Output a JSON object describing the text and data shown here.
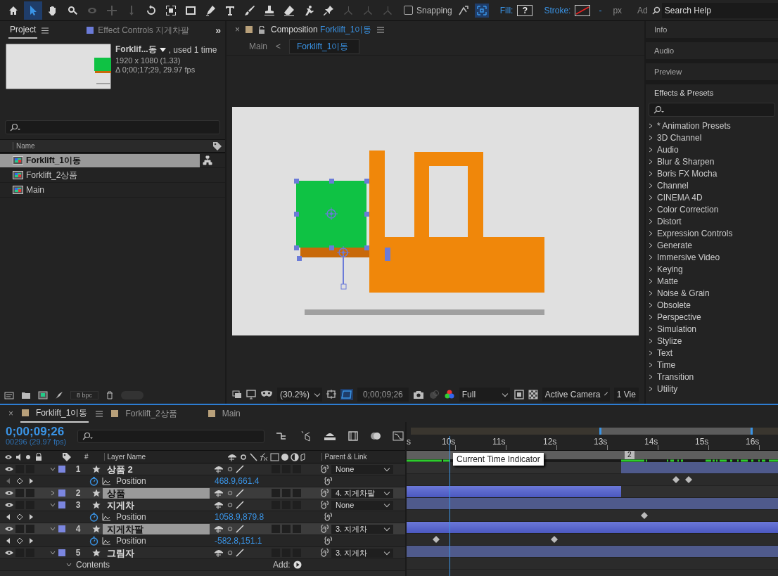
{
  "toolbar": {
    "tools": [
      {
        "kind": "home",
        "selected": false,
        "disabled": false
      },
      {
        "kind": "arrow",
        "selected": true,
        "disabled": false
      },
      {
        "kind": "hand",
        "selected": false,
        "disabled": false
      },
      {
        "kind": "zoom",
        "selected": false,
        "disabled": false
      },
      {
        "kind": "orbit",
        "selected": false,
        "disabled": true
      },
      {
        "kind": "pan",
        "selected": false,
        "disabled": true
      },
      {
        "kind": "dolly",
        "selected": false,
        "disabled": true
      },
      {
        "kind": "rotate",
        "selected": false,
        "disabled": false
      },
      {
        "kind": "region",
        "selected": false,
        "disabled": false
      },
      {
        "kind": "rectangle",
        "selected": false,
        "disabled": false
      },
      {
        "kind": "pen",
        "selected": false,
        "disabled": false
      },
      {
        "kind": "type",
        "selected": false,
        "disabled": false
      },
      {
        "kind": "brush",
        "selected": false,
        "disabled": false
      },
      {
        "kind": "stamp",
        "selected": false,
        "disabled": false
      },
      {
        "kind": "eraser",
        "selected": false,
        "disabled": false
      },
      {
        "kind": "puppet",
        "selected": false,
        "disabled": false
      },
      {
        "kind": "pin",
        "selected": false,
        "disabled": false
      },
      {
        "kind": "axis",
        "selected": false,
        "disabled": true
      },
      {
        "kind": "axis",
        "selected": false,
        "disabled": true
      },
      {
        "kind": "axis",
        "selected": false,
        "disabled": true
      }
    ],
    "snapping": {
      "label": "Snapping",
      "checked": false
    },
    "fill_label": "Fill:",
    "fill_value": "?",
    "stroke_label": "Stroke:",
    "stroke_width": "-",
    "stroke_unit": "px",
    "add_label": "Ad",
    "search": {
      "placeholder": "Search Help"
    }
  },
  "project": {
    "tabs": [
      {
        "label": "Project",
        "selected": true
      },
      {
        "label": "Effect Controls 지게차팔",
        "selected": false
      }
    ],
    "more": "»",
    "info": {
      "name": "Forklif...동",
      "usage": ", used 1 time",
      "size": "1920 x 1080 (1.33)",
      "duration": "Δ 0;00;17;29, 29.97 fps"
    },
    "column": "Name",
    "items": [
      {
        "name": "Forklift_1이동",
        "selected": true
      },
      {
        "name": "Forklift_2상품",
        "selected": false
      },
      {
        "name": "Main",
        "selected": false
      }
    ],
    "depth": "8 bpc"
  },
  "composition": {
    "close": "×",
    "tab_prefix": "Composition",
    "tab_name": "Forklift_1이동",
    "breadcrumb_root": "Main",
    "breadcrumb_sep": "<",
    "breadcrumb_current": "Forklift_1이동",
    "zoom": "(30.2%)",
    "timecode": "0;00;09;26",
    "resolution": "Full",
    "camera": "Active Camera",
    "views": "1 Vie"
  },
  "right_panels": [
    {
      "title": "Info"
    },
    {
      "title": "Audio"
    },
    {
      "title": "Preview"
    },
    {
      "title": "Effects & Presets"
    }
  ],
  "effects": [
    "* Animation Presets",
    "3D Channel",
    "Audio",
    "Blur & Sharpen",
    "Boris FX Mocha",
    "Channel",
    "CINEMA 4D",
    "Color Correction",
    "Distort",
    "Expression Controls",
    "Generate",
    "Immersive Video",
    "Keying",
    "Matte",
    "Noise & Grain",
    "Obsolete",
    "Perspective",
    "Simulation",
    "Stylize",
    "Text",
    "Time",
    "Transition",
    "Utility"
  ],
  "timeline": {
    "close": "×",
    "tabs": [
      {
        "label": "Forklift_1이동",
        "selected": true
      },
      {
        "label": "Forklift_2상품",
        "selected": false
      },
      {
        "label": "Main",
        "selected": false
      }
    ],
    "time": "0;00;09;26",
    "frames": "00296 (29.97 fps)",
    "headers": {
      "number": "#",
      "name": "Layer Name",
      "parent": "Parent & Link"
    },
    "ruler": [
      "s",
      "10s",
      "11s",
      "12s",
      "13s",
      "14s",
      "15s",
      "16s"
    ],
    "marker": "2",
    "tooltip": "Current Time Indicator",
    "rows": [
      {
        "kind": "layer",
        "number": "1",
        "name": "상품 2",
        "selected": false,
        "expanded": true,
        "parent": "None",
        "color": "#7b86e0"
      },
      {
        "kind": "property",
        "name": "Position",
        "value": "468.9,661.4"
      },
      {
        "kind": "layer",
        "number": "2",
        "name": "상품",
        "selected": true,
        "expanded": false,
        "parent": "4. 지게차팔",
        "color": "#7b86e0"
      },
      {
        "kind": "layer",
        "number": "3",
        "name": "지게차",
        "selected": false,
        "expanded": true,
        "parent": "None",
        "color": "#7b86e0"
      },
      {
        "kind": "property",
        "name": "Position",
        "value": "1058.9,879.8"
      },
      {
        "kind": "layer",
        "number": "4",
        "name": "지게차팔",
        "selected": true,
        "expanded": true,
        "parent": "3. 지게차",
        "color": "#7b86e0"
      },
      {
        "kind": "property",
        "name": "Position",
        "value": "-582.8,151.1"
      },
      {
        "kind": "layer",
        "number": "5",
        "name": "그림자",
        "selected": false,
        "expanded": true,
        "parent": "3. 지게차",
        "color": "#7b86e0"
      },
      {
        "kind": "group",
        "name": "Contents",
        "action": "Add:"
      }
    ]
  }
}
